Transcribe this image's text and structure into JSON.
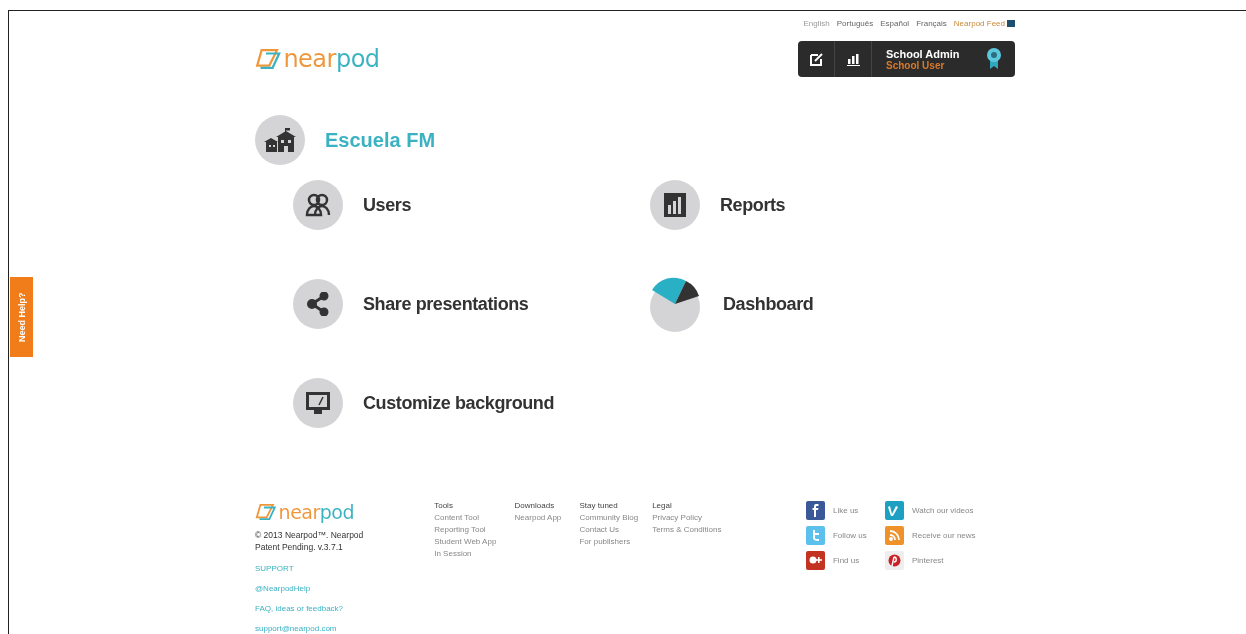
{
  "languages": [
    {
      "label": "English",
      "selected": true
    },
    {
      "label": "Português",
      "selected": false
    },
    {
      "label": "Español",
      "selected": false
    },
    {
      "label": "Français",
      "selected": false
    }
  ],
  "logo": "nearpod",
  "feed_link": "Nearpod Feed",
  "user_box": {
    "name": "School Admin",
    "role": "School User"
  },
  "school": {
    "name": "Escuela FM"
  },
  "menu": [
    {
      "kind": "users",
      "label": "Users"
    },
    {
      "kind": "reports",
      "label": "Reports"
    },
    {
      "kind": "share",
      "label": "Share presentations"
    },
    {
      "kind": "dashboard",
      "label": "Dashboard"
    },
    {
      "kind": "background",
      "label": "Customize background"
    }
  ],
  "help_tab": "Need Help?",
  "footer": {
    "logo": "nearpod",
    "copyright": "© 2013 Nearpod™. Nearpod Patent Pending. v.3.7.1",
    "links": [
      "SUPPORT",
      "@NearpodHelp",
      "FAQ, ideas or feedback?",
      "support@nearpod.com"
    ],
    "columns": [
      {
        "title": "Tools",
        "items": [
          "Content Tool",
          "Reporting Tool",
          "Student Web App",
          "In Session"
        ]
      },
      {
        "title": "Downloads",
        "items": [
          "Nearpod App"
        ]
      },
      {
        "title": "Stay tuned",
        "items": [
          "Community Blog",
          "Contact Us",
          "For publishers"
        ]
      },
      {
        "title": "Legal",
        "items": [
          "Privacy Policy",
          "Terms & Conditions"
        ]
      }
    ],
    "social": [
      {
        "kind": "facebook",
        "label": "Like us"
      },
      {
        "kind": "vimeo",
        "label": "Watch our videos"
      },
      {
        "kind": "twitter",
        "label": "Follow us"
      },
      {
        "kind": "rss",
        "label": "Receive our news"
      },
      {
        "kind": "googleplus",
        "label": "Find us"
      },
      {
        "kind": "pinterest",
        "label": "Pinterest"
      }
    ]
  }
}
